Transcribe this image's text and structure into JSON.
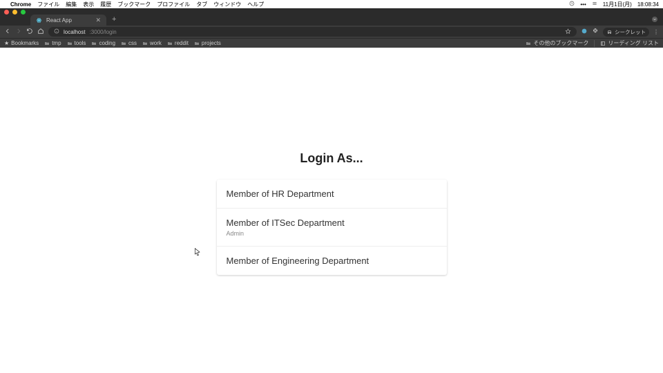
{
  "menubar": {
    "app": "Chrome",
    "items": [
      "ファイル",
      "編集",
      "表示",
      "履歴",
      "ブックマーク",
      "プロファイル",
      "タブ",
      "ウィンドウ",
      "ヘルプ"
    ],
    "date": "11月1日(月)",
    "time": "18:08:34"
  },
  "browser": {
    "tab_title": "React App",
    "url_host": "localhost",
    "url_path": ":3000/login",
    "incognito_label": "シークレット",
    "bookmarks": [
      "Bookmarks",
      "tmp",
      "tools",
      "coding",
      "css",
      "work",
      "reddit",
      "projects"
    ],
    "other_bookmarks": "その他のブックマーク",
    "reading_list": "リーディング リスト"
  },
  "page": {
    "heading": "Login As...",
    "options": [
      {
        "title": "Member of HR Department",
        "sub": ""
      },
      {
        "title": "Member of ITSec Department",
        "sub": "Admin"
      },
      {
        "title": "Member of Engineering Department",
        "sub": ""
      }
    ]
  }
}
